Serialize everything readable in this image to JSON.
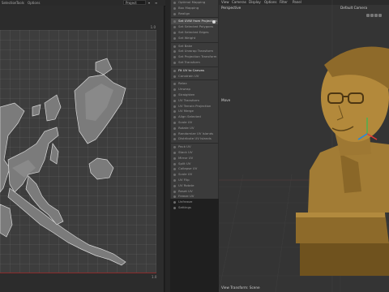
{
  "topbar": {
    "items": [
      "Selection",
      "Tools",
      "Options"
    ],
    "project_select": "Project"
  },
  "uv_editor": {
    "axis_top_right": "1.0",
    "axis_bottom_right": "1.0"
  },
  "uv_menu": {
    "items": [
      {
        "label": "Optimal Mapping",
        "state": "normal"
      },
      {
        "label": "Box Mapping",
        "state": "normal"
      },
      {
        "label": "Realign",
        "state": "normal"
      },
      {
        "label": "",
        "state": "sep"
      },
      {
        "label": "Set UVW from Projection",
        "state": "active"
      },
      {
        "label": "Set Selected Polygons",
        "state": "normal"
      },
      {
        "label": "Set Selected Edges",
        "state": "normal"
      },
      {
        "label": "Set Weight",
        "state": "normal"
      },
      {
        "label": "",
        "state": "sep"
      },
      {
        "label": "Set Bake",
        "state": "normal"
      },
      {
        "label": "Set Unwrap Transform",
        "state": "normal"
      },
      {
        "label": "Set Projection Transform",
        "state": "normal"
      },
      {
        "label": "Set Transform",
        "state": "normal"
      },
      {
        "label": "",
        "state": "sep"
      },
      {
        "label": "Fit UV to Canvas",
        "state": "header"
      },
      {
        "label": "Constrain UV",
        "state": "normal"
      },
      {
        "label": "",
        "state": "sep"
      },
      {
        "label": "Relax",
        "state": "normal"
      },
      {
        "label": "Unwrap",
        "state": "normal"
      },
      {
        "label": "Straighten",
        "state": "normal"
      },
      {
        "label": "UV Transform",
        "state": "normal"
      },
      {
        "label": "UV Terrain Projection",
        "state": "normal"
      },
      {
        "label": "UV Merge",
        "state": "normal"
      },
      {
        "label": "Align Selected",
        "state": "normal"
      },
      {
        "label": "Scale UV",
        "state": "normal"
      },
      {
        "label": "Rotate UV",
        "state": "normal"
      },
      {
        "label": "Randomize UV Islands",
        "state": "normal"
      },
      {
        "label": "Distribute UV Islands",
        "state": "normal"
      },
      {
        "label": "",
        "state": "sep"
      },
      {
        "label": "Pack UV",
        "state": "normal"
      },
      {
        "label": "Stack UV",
        "state": "normal"
      },
      {
        "label": "Mirror UV",
        "state": "normal"
      },
      {
        "label": "Split UV",
        "state": "normal"
      },
      {
        "label": "Collapse UV",
        "state": "normal"
      },
      {
        "label": "Scale UV",
        "state": "normal"
      },
      {
        "label": "UV Flip",
        "state": "normal"
      },
      {
        "label": "UV Rotate",
        "state": "normal"
      },
      {
        "label": "Reset UV",
        "state": "normal"
      },
      {
        "label": "Freeze UV",
        "state": "normal"
      },
      {
        "label": "Unfreeze",
        "state": "normal"
      },
      {
        "label": "Settings",
        "state": "normal"
      }
    ]
  },
  "viewport": {
    "menubar": [
      "View",
      "Cameras",
      "Display",
      "Options",
      "Filter",
      "Panel"
    ],
    "perspective_label": "Perspective",
    "camera_label": "Default Camera",
    "move_label": "Move",
    "footer_label": "View Transform: Scene"
  }
}
